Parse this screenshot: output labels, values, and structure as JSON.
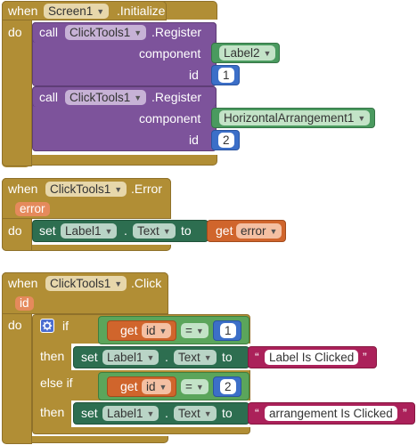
{
  "block1": {
    "when": "when",
    "component": "Screen1",
    "event": ".Initialize",
    "do": "do",
    "calls": [
      {
        "call": "call",
        "component": "ClickTools1",
        "method": ".Register",
        "param1_label": "component",
        "param1_value": "Label2",
        "param2_label": "id",
        "param2_value": "1"
      },
      {
        "call": "call",
        "component": "ClickTools1",
        "method": ".Register",
        "param1_label": "component",
        "param1_value": "HorizontalArrangement1",
        "param2_label": "id",
        "param2_value": "2"
      }
    ]
  },
  "block2": {
    "when": "when",
    "component": "ClickTools1",
    "event": ".Error",
    "param": "error",
    "do": "do",
    "set": "set",
    "target": "Label1",
    "dot": ".",
    "prop": "Text",
    "to": "to",
    "get": "get",
    "get_var": "error"
  },
  "block3": {
    "when": "when",
    "component": "ClickTools1",
    "event": ".Click",
    "param": "id",
    "do": "do",
    "if": "if",
    "then": "then",
    "else_if": "else if",
    "get": "get",
    "var": "id",
    "eq": "=",
    "value1": "1",
    "value2": "2",
    "set": "set",
    "target": "Label1",
    "dot": ".",
    "prop": "Text",
    "to": "to",
    "quote_open": "“",
    "quote_close": "”",
    "text1": "Label Is Clicked",
    "text2": "arrangement Is Clicked"
  },
  "colors": {
    "event": "#b18e35",
    "procedure": "#7d539b",
    "component": "#4a9a5f",
    "setter": "#2d6e50",
    "math": "#3c6fc8",
    "variable": "#d0652c",
    "text": "#ab215a"
  }
}
